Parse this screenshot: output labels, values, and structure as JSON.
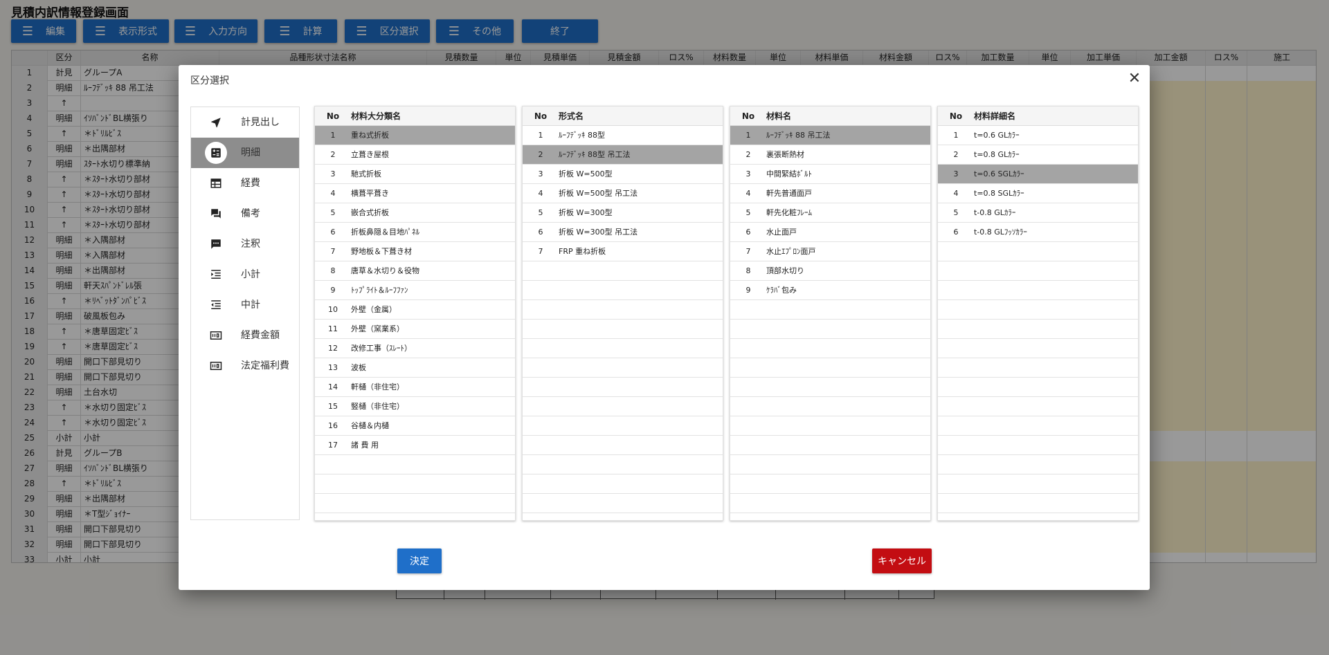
{
  "page": {
    "title": "見積内訳情報登録画面"
  },
  "toolbar": {
    "menu_icon": "menu-icon",
    "buttons": [
      {
        "label": "編集"
      },
      {
        "label": "表示形式"
      },
      {
        "label": "入力方向"
      },
      {
        "label": "計算"
      },
      {
        "label": "区分選択"
      },
      {
        "label": "その他"
      },
      {
        "label": "終了"
      }
    ]
  },
  "grid": {
    "columns": [
      "",
      "区分",
      "名称",
      "品種形状寸法名称",
      "見積数量",
      "単位",
      "見積単価",
      "見積金額",
      "ロス%",
      "材料数量",
      "単位",
      "材料単価",
      "材料金額",
      "ロス%",
      "加工数量",
      "単位",
      "加工単価",
      "加工金額",
      "ロス%",
      "施工"
    ],
    "rows": [
      {
        "no": "1",
        "kubun": "計見",
        "name": "グループA"
      },
      {
        "no": "2",
        "kubun": "明細",
        "name": "ﾙｰﾌﾃﾞｯｷ 88 吊工法"
      },
      {
        "no": "3",
        "kubun": "↑",
        "name": ""
      },
      {
        "no": "4",
        "kubun": "明細",
        "name": "ｲｿﾊﾞﾝﾄﾞBL横張り"
      },
      {
        "no": "5",
        "kubun": "↑",
        "name": "＊ﾄﾞﾘﾙﾋﾞｽ"
      },
      {
        "no": "6",
        "kubun": "明細",
        "name": "＊出隅部材"
      },
      {
        "no": "7",
        "kubun": "明細",
        "name": "ｽﾀｰﾄ水切り標準納"
      },
      {
        "no": "8",
        "kubun": "↑",
        "name": "＊ｽﾀｰﾄ水切り部材"
      },
      {
        "no": "9",
        "kubun": "↑",
        "name": "＊ｽﾀｰﾄ水切り部材"
      },
      {
        "no": "10",
        "kubun": "↑",
        "name": "＊ｽﾀｰﾄ水切り部材"
      },
      {
        "no": "11",
        "kubun": "↑",
        "name": "＊ｽﾀｰﾄ水切り部材"
      },
      {
        "no": "12",
        "kubun": "明細",
        "name": "＊入隅部材"
      },
      {
        "no": "13",
        "kubun": "明細",
        "name": "＊入隅部材"
      },
      {
        "no": "14",
        "kubun": "明細",
        "name": "＊出隅部材"
      },
      {
        "no": "15",
        "kubun": "明細",
        "name": "軒天ｽﾊﾟﾝﾄﾞﾚﾙ張"
      },
      {
        "no": "16",
        "kubun": "↑",
        "name": "＊ﾘﾍﾞｯﾄﾀﾞﾝﾊﾟﾋﾞｽ"
      },
      {
        "no": "17",
        "kubun": "明細",
        "name": "破風板包み"
      },
      {
        "no": "18",
        "kubun": "↑",
        "name": "＊唐草固定ﾋﾞｽ"
      },
      {
        "no": "19",
        "kubun": "↑",
        "name": "＊唐草固定ﾋﾞｽ"
      },
      {
        "no": "20",
        "kubun": "明細",
        "name": "開口下部見切り"
      },
      {
        "no": "21",
        "kubun": "明細",
        "name": "開口下部見切り"
      },
      {
        "no": "22",
        "kubun": "明細",
        "name": "土台水切"
      },
      {
        "no": "23",
        "kubun": "↑",
        "name": "＊水切り固定ﾋﾞｽ"
      },
      {
        "no": "24",
        "kubun": "↑",
        "name": "＊水切り固定ﾋﾞｽ"
      },
      {
        "no": "25",
        "kubun": "小計",
        "name": "小計"
      },
      {
        "no": "26",
        "kubun": "計見",
        "name": "グループB"
      },
      {
        "no": "27",
        "kubun": "明細",
        "name": "ｲｿﾊﾞﾝﾄﾞBL横張り"
      },
      {
        "no": "28",
        "kubun": "↑",
        "name": "＊ﾄﾞﾘﾙﾋﾞｽ"
      },
      {
        "no": "29",
        "kubun": "明細",
        "name": "＊出隅部材"
      },
      {
        "no": "30",
        "kubun": "明細",
        "name": "＊T型ｼﾞｮｲﾅｰ"
      },
      {
        "no": "31",
        "kubun": "明細",
        "name": "開口下部見切り"
      },
      {
        "no": "32",
        "kubun": "明細",
        "name": "開口下部見切り"
      },
      {
        "no": "33",
        "kubun": "小計",
        "name": "小計"
      }
    ]
  },
  "dialog": {
    "title": "区分選択",
    "close_icon": "close-icon",
    "ok_label": "決定",
    "cancel_label": "キャンセル",
    "sidebar": [
      {
        "label": "計見出し",
        "icon": "navigation-arrow-icon"
      },
      {
        "label": "明細",
        "icon": "calculator-icon",
        "selected": true
      },
      {
        "label": "経費",
        "icon": "table-icon"
      },
      {
        "label": "備考",
        "icon": "forum-icon"
      },
      {
        "label": "注釈",
        "icon": "chat-bubble-icon"
      },
      {
        "label": "小計",
        "icon": "format-indent-increase-icon"
      },
      {
        "label": "中計",
        "icon": "format-indent-decrease-icon"
      },
      {
        "label": "経費金額",
        "icon": "money-icon"
      },
      {
        "label": "法定福利費",
        "icon": "money-icon"
      }
    ],
    "panels": [
      {
        "no_header": "No",
        "name_header": "材料大分類名",
        "selected": 0,
        "items": [
          "重ね式折板",
          "立葺き屋根",
          "馳式折板",
          "横葺平葺き",
          "嵌合式折板",
          "折板鼻隠＆目地ﾊﾟﾈﾙ",
          "野地板＆下葺き材",
          "唐草＆水切り＆役物",
          "ﾄｯﾌﾟﾗｲﾄ＆ﾙｰﾌﾌｧﾝ",
          "外壁（金属）",
          "外壁（窯業系）",
          "改修工事（ｽﾚｰﾄ）",
          "波板",
          "軒樋（非住宅）",
          "竪樋（非住宅）",
          "谷樋＆内樋",
          "諸 費 用"
        ]
      },
      {
        "no_header": "No",
        "name_header": "形式名",
        "selected": 1,
        "items": [
          "ﾙｰﾌﾃﾞｯｷ 88型",
          "ﾙｰﾌﾃﾞｯｷ 88型 吊工法",
          "折板 W=500型",
          "折板 W=500型 吊工法",
          "折板 W=300型",
          "折板 W=300型 吊工法",
          "FRP 重ね折板"
        ]
      },
      {
        "no_header": "No",
        "name_header": "材料名",
        "selected": 0,
        "items": [
          "ﾙｰﾌﾃﾞｯｷ 88 吊工法",
          "裏張断熱材",
          "中間緊結ﾎﾞﾙﾄ",
          "軒先普通面戸",
          "軒先化粧ﾌﾚｰﾑ",
          "水止面戸",
          "水止ｴﾌﾟﾛﾝ面戸",
          "頂部水切り",
          "ｹﾗﾊﾞ包み"
        ]
      },
      {
        "no_header": "No",
        "name_header": "材料詳細名",
        "selected": 2,
        "items": [
          "t=0.6 GLｶﾗｰ",
          "t=0.8 GLｶﾗｰ",
          "t=0.6 SGLｶﾗｰ",
          "t=0.8 SGLｶﾗｰ",
          "t-0.8 GLｶﾗｰ",
          "t-0.8 GLﾌｯｿｶﾗｰ"
        ]
      }
    ]
  },
  "colors": {
    "button_primary": "#1f6fc9",
    "button_cancel": "#c30d12",
    "selected_row": "#a4a4a4",
    "selected_nav": "#8d8d8d",
    "grid_value_fill": "#fff3cc"
  }
}
